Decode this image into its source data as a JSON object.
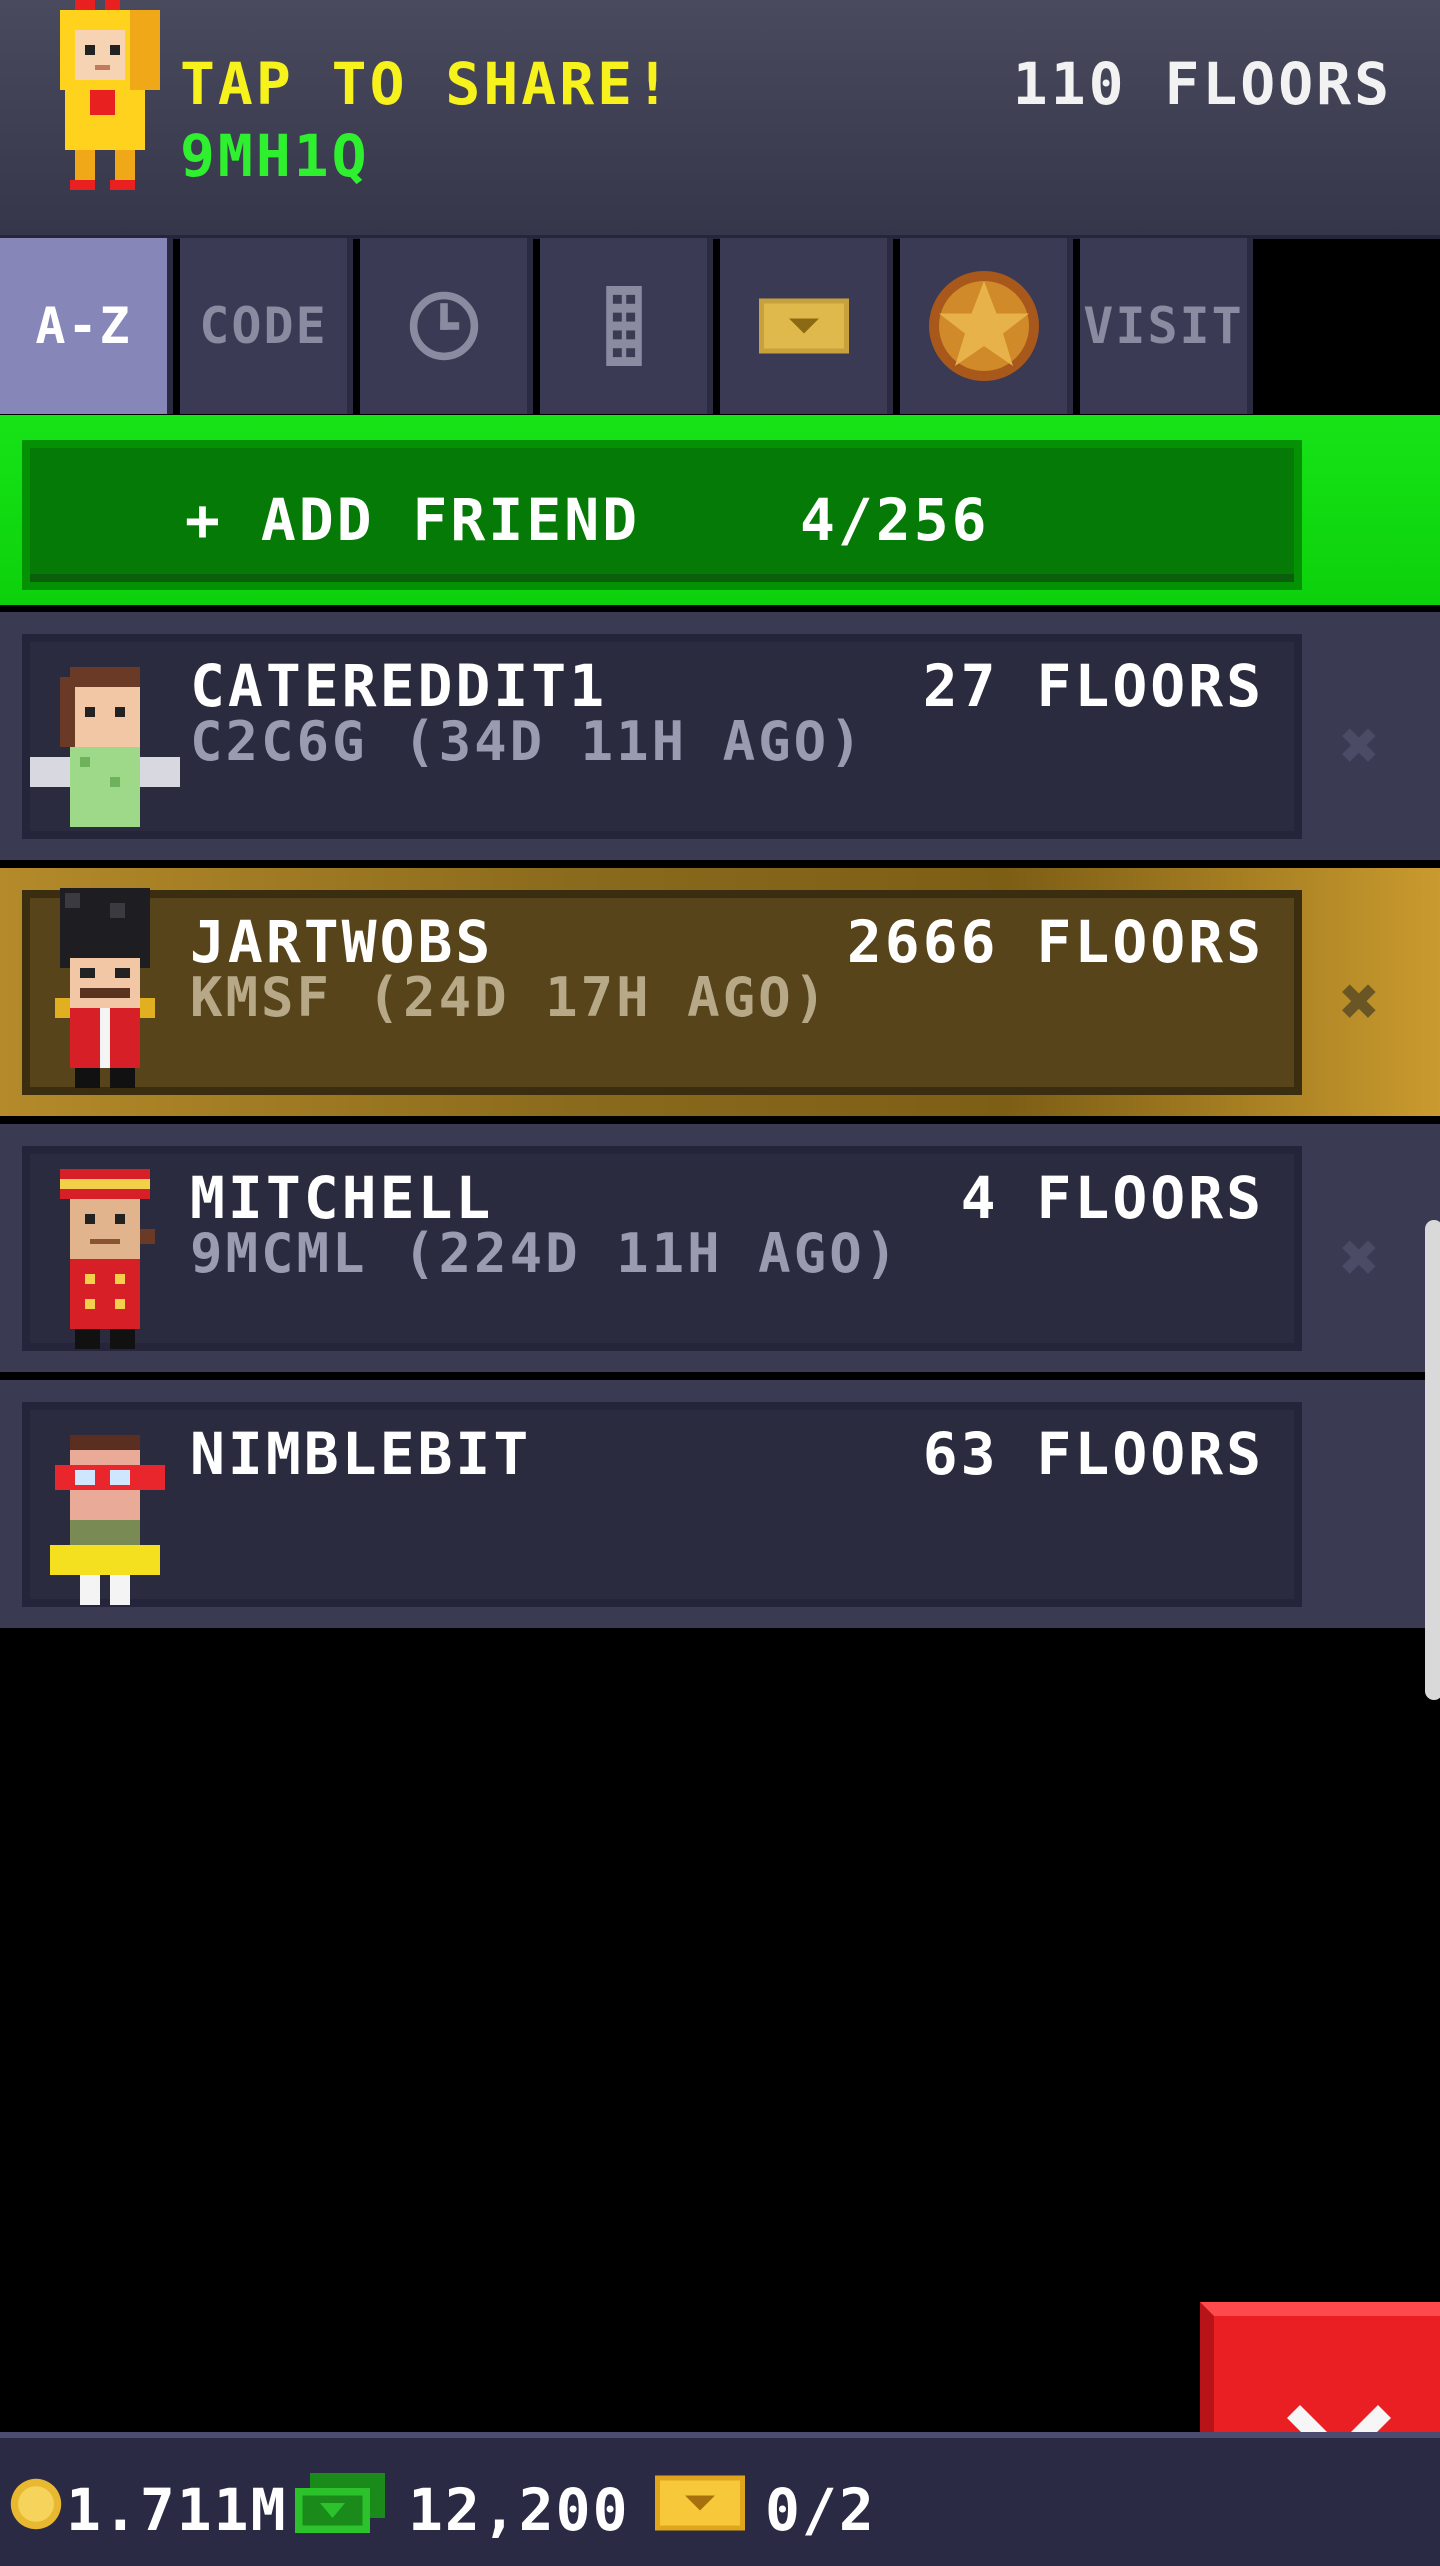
{
  "header": {
    "share_text": "TAP TO SHARE!",
    "player_code": "9MH1Q",
    "floors": "110 FLOORS"
  },
  "tabs": [
    {
      "label": "A-Z",
      "active": true
    },
    {
      "label": "CODE"
    },
    {
      "icon": "clock-icon"
    },
    {
      "icon": "building-icon"
    },
    {
      "icon": "ticket-icon"
    },
    {
      "icon": "star-medal-icon"
    },
    {
      "label": "VISIT"
    }
  ],
  "add_friend": {
    "label": "+ ADD FRIEND",
    "count": "4/256"
  },
  "friends": [
    {
      "name": "CATEREDDIT1",
      "floors": "27 FLOORS",
      "sub": "C2C6G (34D 11H AGO)",
      "highlighted": false
    },
    {
      "name": "JARTWOBS",
      "floors": "2666 FLOORS",
      "sub": "KMSF (24D 17H AGO)",
      "highlighted": true
    },
    {
      "name": "MITCHELL",
      "floors": "4 FLOORS",
      "sub": "9MCML (224D 11H AGO)",
      "highlighted": false
    },
    {
      "name": "NIMBLEBIT",
      "floors": "63 FLOORS",
      "sub": "",
      "highlighted": false
    }
  ],
  "bottom": {
    "coins": "1.711M",
    "bux": "12,200",
    "tickets": "0/2"
  },
  "colors": {
    "accent_green": "#0cd10c",
    "gold_row": "#8a6a1c",
    "close_red": "#ea1f24",
    "share_yellow": "#f7f21c",
    "code_green": "#2ff02f"
  }
}
